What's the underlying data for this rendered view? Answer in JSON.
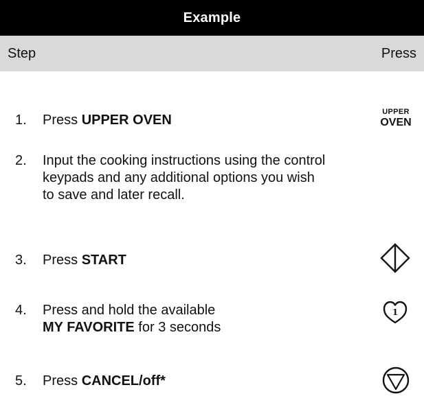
{
  "table": {
    "title": "Example",
    "col_step": "Step",
    "col_press": "Press"
  },
  "steps": [
    {
      "number": "1.",
      "text_prefix": "Press ",
      "text_bold": "UPPER OVEN",
      "press_label_line1": "UPPER",
      "press_label_line2": "OVEN"
    },
    {
      "number": "2.",
      "line1": "Input the cooking instructions using the control",
      "line2": "keypads and any additional options you wish",
      "line3": "to save and later recall."
    },
    {
      "number": "3.",
      "text_prefix": "Press ",
      "text_bold": "START",
      "icon": "start-diamond-icon"
    },
    {
      "number": "4.",
      "line1": "Press and hold the available",
      "line2_bold": "MY FAVORITE",
      "line2_rest": " for 3 seconds",
      "icon": "favorite-heart-icon",
      "icon_label": "1"
    },
    {
      "number": "5.",
      "text_prefix": "Press ",
      "text_bold": "CANCEL/off*",
      "icon": "cancel-triangle-icon"
    }
  ]
}
